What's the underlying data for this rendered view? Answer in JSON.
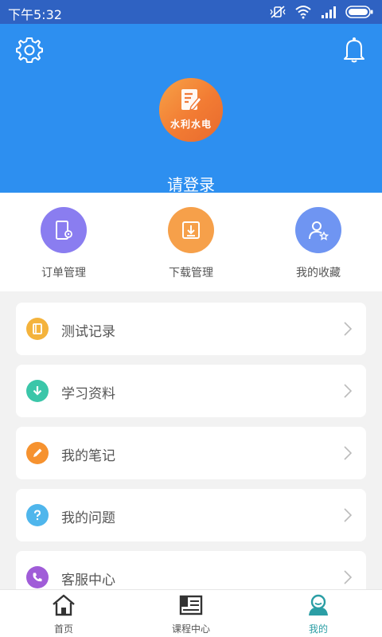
{
  "status_bar": {
    "time": "下午5:32",
    "icons": [
      "no-vibrate-icon",
      "wifi-icon",
      "signal-icon",
      "battery-icon"
    ]
  },
  "header": {
    "settings_icon": "gear-icon",
    "notification_icon": "bell-icon",
    "avatar_brand": "水利水电",
    "login_prompt": "请登录",
    "bg_color": "#2d8ff0"
  },
  "quick_actions": [
    {
      "label": "订单管理",
      "icon": "order-settings-icon",
      "color": "#8a7df0"
    },
    {
      "label": "下载管理",
      "icon": "download-icon",
      "color": "#f6a04a"
    },
    {
      "label": "我的收藏",
      "icon": "favorite-user-icon",
      "color": "#6f95f2"
    }
  ],
  "menu_items": [
    {
      "label": "测试记录",
      "icon": "notebook-icon",
      "color": "#f4b33c"
    },
    {
      "label": "学习资料",
      "icon": "download-arrow-icon",
      "color": "#3bc6a9"
    },
    {
      "label": "我的笔记",
      "icon": "pencil-icon",
      "color": "#f6922f"
    },
    {
      "label": "我的问题",
      "icon": "question-icon",
      "color": "#4fb6ec"
    },
    {
      "label": "客服中心",
      "icon": "phone-icon",
      "color": "#a05cd8"
    }
  ],
  "tab_bar": [
    {
      "label": "首页",
      "icon": "home-icon",
      "active": false
    },
    {
      "label": "课程中心",
      "icon": "course-icon",
      "active": false
    },
    {
      "label": "我的",
      "icon": "profile-icon",
      "active": true
    }
  ]
}
